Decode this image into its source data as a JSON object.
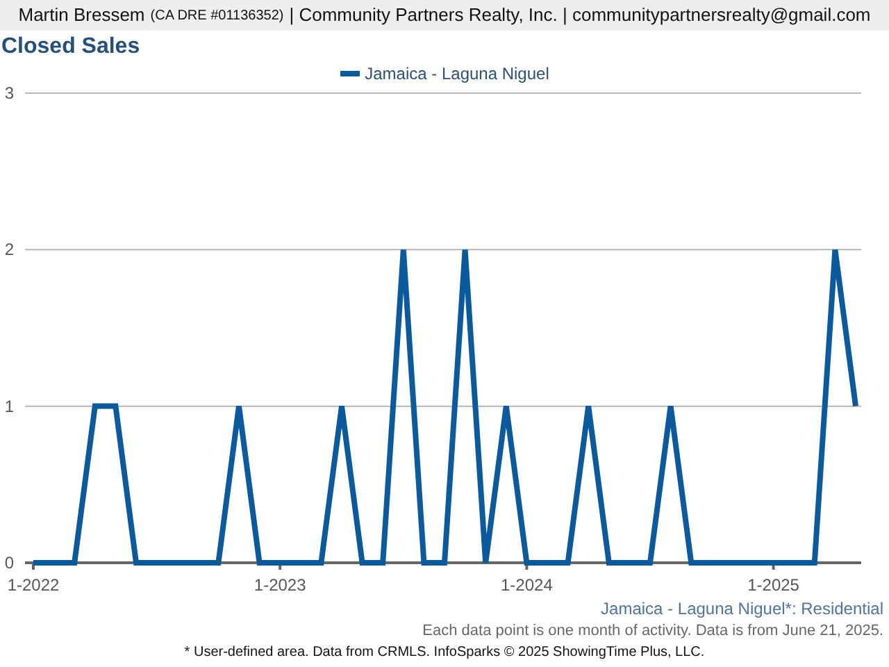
{
  "header": {
    "agent": "Martin Bressem",
    "license": "(CA DRE #01136352)",
    "company": "| Community Partners Realty, Inc. | communitypartnersrealty@gmail.com"
  },
  "title": "Closed Sales",
  "chart_data": {
    "type": "line",
    "categories": [
      "1-2022",
      null,
      null,
      null,
      null,
      null,
      null,
      null,
      null,
      null,
      null,
      null,
      "1-2023",
      null,
      null,
      null,
      null,
      null,
      null,
      null,
      null,
      null,
      null,
      null,
      "1-2024",
      null,
      null,
      null,
      null,
      null,
      null,
      null,
      null,
      null,
      null,
      null,
      "1-2025",
      null,
      null,
      null,
      null
    ],
    "series": [
      {
        "name": "Jamaica - Laguna Niguel",
        "color": "#0b5a9e",
        "values": [
          0,
          0,
          0,
          1,
          1,
          0,
          0,
          0,
          0,
          0,
          1,
          0,
          0,
          0,
          0,
          1,
          0,
          0,
          2,
          0,
          0,
          2,
          0,
          1,
          0,
          0,
          0,
          1,
          0,
          0,
          0,
          1,
          0,
          0,
          0,
          0,
          0,
          0,
          0,
          2,
          1
        ]
      }
    ],
    "ylim": [
      0,
      3
    ],
    "yticks": [
      0,
      1,
      2,
      3
    ]
  },
  "subtitle": "Jamaica - Laguna Niguel*: Residential",
  "note": "Each data point is one month of activity. Data is from June 21, 2025.",
  "footer": "* User-defined area. Data from CRMLS. InfoSparks © 2025 ShowingTime Plus, LLC."
}
